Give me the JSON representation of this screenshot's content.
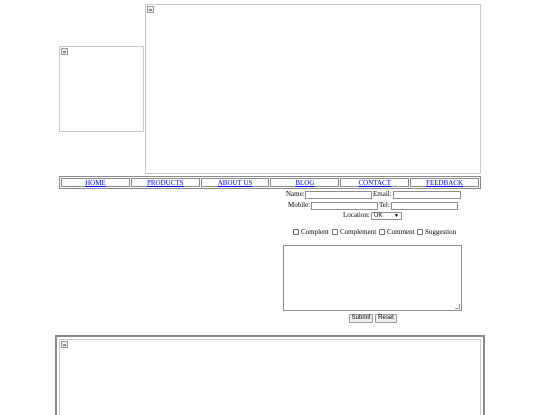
{
  "nav": {
    "items": [
      {
        "label": "HOME"
      },
      {
        "label": "PRODUCTS"
      },
      {
        "label": "ABOUT US"
      },
      {
        "label": "BLOG"
      },
      {
        "label": "CONTACT"
      },
      {
        "label": "FEEDBACK"
      }
    ]
  },
  "form": {
    "name_label": "Name:",
    "email_label": "Email:",
    "mobile_label": "Mobile:",
    "tel_label": "Tel:",
    "location_label": "Location:",
    "location_value": "UK",
    "checkboxes": [
      {
        "label": "Complent"
      },
      {
        "label": "Complement"
      },
      {
        "label": "Comment"
      },
      {
        "label": "Suggestion"
      }
    ],
    "submit_label": "Submit",
    "reset_label": "Reset"
  },
  "icons": {
    "broken_image": "broken-image-icon",
    "select_caret": "chevron-down-icon"
  },
  "colors": {
    "link": "#0000ee",
    "border": "#8a8a8a"
  }
}
